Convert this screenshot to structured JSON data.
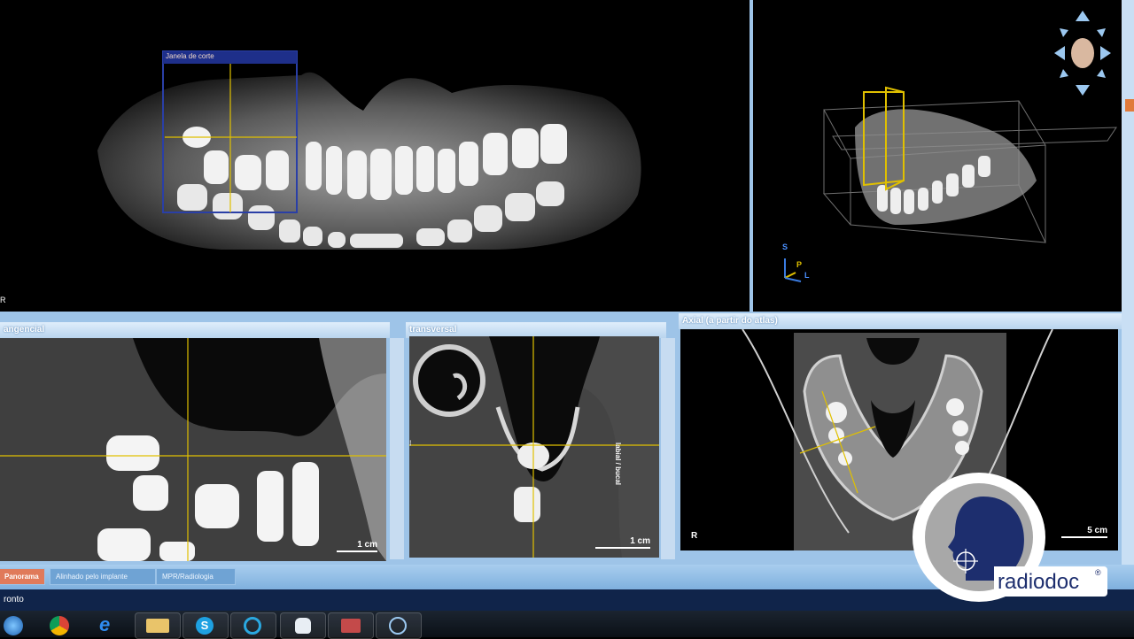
{
  "panels": {
    "panorama": {
      "cut_window_label": "Janela de corte",
      "corner_label": "R"
    },
    "volume3d": {
      "orientation_labels": {
        "s": "S",
        "p": "P",
        "l": "L"
      }
    },
    "tangential": {
      "title": "angencial",
      "scale": "1 cm"
    },
    "transversal": {
      "title": "transversal",
      "side_label_left": "...",
      "side_label_right": "labial / bucal",
      "scale": "1 cm"
    },
    "axial": {
      "title": "Axial (a partir do atlas)",
      "corner_label": "R",
      "scale": "5 cm"
    }
  },
  "tabs": [
    {
      "label": "Panorama",
      "active": true
    },
    {
      "label": "Alinhado pelo implante",
      "active": false
    },
    {
      "label": "MPR/Radiologia",
      "active": false
    }
  ],
  "status": {
    "text": "ronto"
  },
  "watermark": {
    "brand": "radiodoc",
    "registered": "®"
  },
  "taskbar": {
    "items": [
      {
        "icon": "windows-icon"
      },
      {
        "icon": "chrome-icon"
      },
      {
        "icon": "internet-explorer-icon"
      },
      {
        "icon": "folder-icon"
      },
      {
        "icon": "skype-icon"
      },
      {
        "icon": "media-player-icon"
      },
      {
        "icon": "tooth-app-icon"
      },
      {
        "icon": "toolbox-app-icon"
      },
      {
        "icon": "globe-app-icon"
      }
    ]
  },
  "colors": {
    "accent_yellow": "#e0c000",
    "frame_blue": "#9ec4e8",
    "tab_active": "#e07a5a"
  }
}
